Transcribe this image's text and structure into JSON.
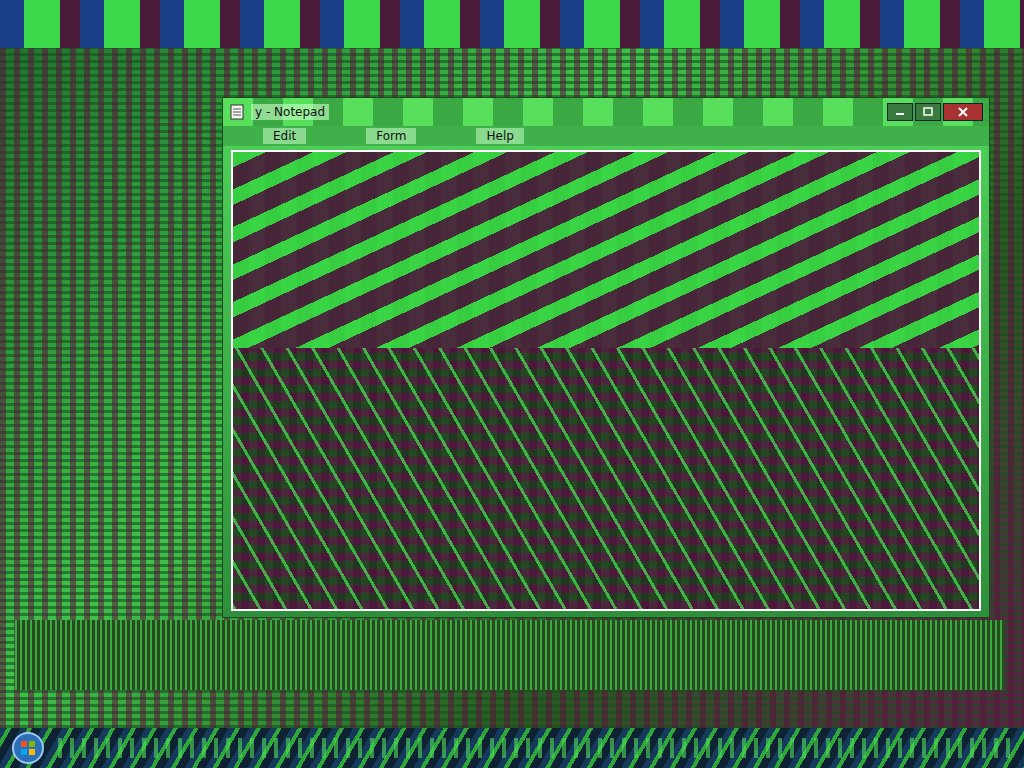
{
  "window": {
    "title": "y - Notepad",
    "menu": [
      {
        "label": "Edit"
      },
      {
        "label": "Form"
      },
      {
        "label": "Help"
      }
    ]
  }
}
